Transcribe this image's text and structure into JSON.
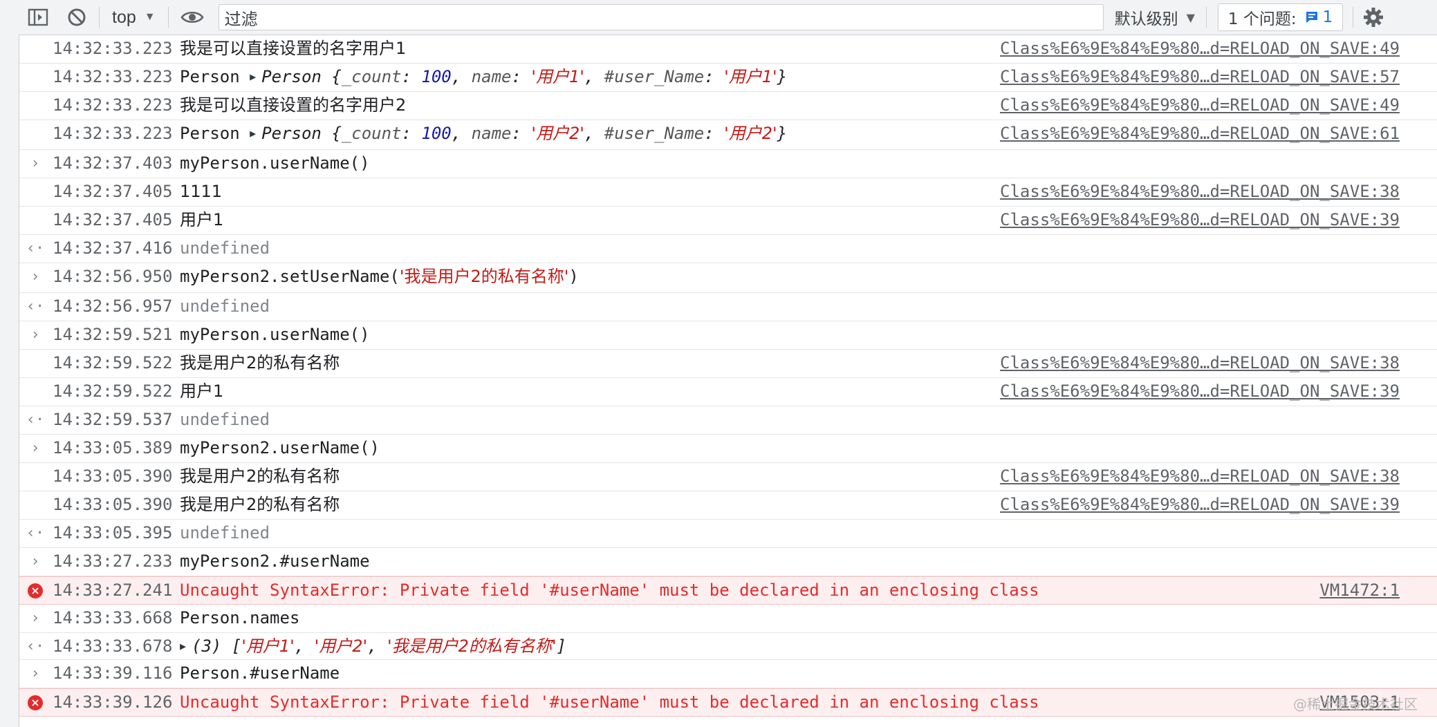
{
  "toolbar": {
    "context": "top",
    "filter_placeholder": "过滤",
    "levels_label": "默认级别",
    "issues_label": "1 个问题:",
    "issues_count": "1"
  },
  "rows": [
    {
      "kind": "log",
      "ts": "14:32:33.223",
      "text": "我是可以直接设置的名字用户1",
      "src": "Class%E6%9E%84%E9%80…d=RELOAD_ON_SAVE:49"
    },
    {
      "kind": "obj",
      "ts": "14:32:33.223",
      "label": "Person",
      "cls": "Person",
      "count": "100",
      "name": "'用户1'",
      "uname": "'用户1'",
      "src": "Class%E6%9E%84%E9%80…d=RELOAD_ON_SAVE:57"
    },
    {
      "kind": "log",
      "ts": "14:32:33.223",
      "text": "我是可以直接设置的名字用户2",
      "src": "Class%E6%9E%84%E9%80…d=RELOAD_ON_SAVE:49"
    },
    {
      "kind": "obj",
      "ts": "14:32:33.223",
      "label": "Person",
      "cls": "Person",
      "count": "100",
      "name": "'用户2'",
      "uname": "'用户2'",
      "src": "Class%E6%9E%84%E9%80…d=RELOAD_ON_SAVE:61"
    },
    {
      "kind": "input",
      "ts": "14:32:37.403",
      "text": "myPerson.userName()"
    },
    {
      "kind": "log",
      "ts": "14:32:37.405",
      "text": "1111",
      "src": "Class%E6%9E%84%E9%80…d=RELOAD_ON_SAVE:38"
    },
    {
      "kind": "log",
      "ts": "14:32:37.405",
      "text": "用户1",
      "src": "Class%E6%9E%84%E9%80…d=RELOAD_ON_SAVE:39"
    },
    {
      "kind": "result",
      "ts": "14:32:37.416",
      "text": "undefined"
    },
    {
      "kind": "input-str",
      "ts": "14:32:56.950",
      "pre": "myPerson2.setUserName(",
      "str": "'我是用户2的私有名称'",
      "post": ")"
    },
    {
      "kind": "result",
      "ts": "14:32:56.957",
      "text": "undefined"
    },
    {
      "kind": "input",
      "ts": "14:32:59.521",
      "text": "myPerson.userName()"
    },
    {
      "kind": "log",
      "ts": "14:32:59.522",
      "text": "我是用户2的私有名称",
      "src": "Class%E6%9E%84%E9%80…d=RELOAD_ON_SAVE:38"
    },
    {
      "kind": "log",
      "ts": "14:32:59.522",
      "text": "用户1",
      "src": "Class%E6%9E%84%E9%80…d=RELOAD_ON_SAVE:39"
    },
    {
      "kind": "result",
      "ts": "14:32:59.537",
      "text": "undefined"
    },
    {
      "kind": "input",
      "ts": "14:33:05.389",
      "text": "myPerson2.userName()"
    },
    {
      "kind": "log",
      "ts": "14:33:05.390",
      "text": "我是用户2的私有名称",
      "src": "Class%E6%9E%84%E9%80…d=RELOAD_ON_SAVE:38"
    },
    {
      "kind": "log",
      "ts": "14:33:05.390",
      "text": "我是用户2的私有名称",
      "src": "Class%E6%9E%84%E9%80…d=RELOAD_ON_SAVE:39"
    },
    {
      "kind": "result",
      "ts": "14:33:05.395",
      "text": "undefined"
    },
    {
      "kind": "input",
      "ts": "14:33:27.233",
      "text": "myPerson2.#userName"
    },
    {
      "kind": "error",
      "ts": "14:33:27.241",
      "text": "Uncaught SyntaxError: Private field '#userName' must be declared in an enclosing class",
      "src": "VM1472:1"
    },
    {
      "kind": "input",
      "ts": "14:33:33.668",
      "text": "Person.names"
    },
    {
      "kind": "array",
      "ts": "14:33:33.678",
      "len": "(3)",
      "items": [
        "'用户1'",
        "'用户2'",
        "'我是用户2的私有名称'"
      ]
    },
    {
      "kind": "input",
      "ts": "14:33:39.116",
      "text": "Person.#userName"
    },
    {
      "kind": "error",
      "ts": "14:33:39.126",
      "text": "Uncaught SyntaxError: Private field '#userName' must be declared in an enclosing class",
      "src": "VM1503:1"
    }
  ],
  "watermark": "@稀土掘金技术社区",
  "colors": {
    "error": "#e52b2b",
    "string": "#c41a16",
    "number": "#1a1aa6",
    "accent": "#1a73e8"
  }
}
